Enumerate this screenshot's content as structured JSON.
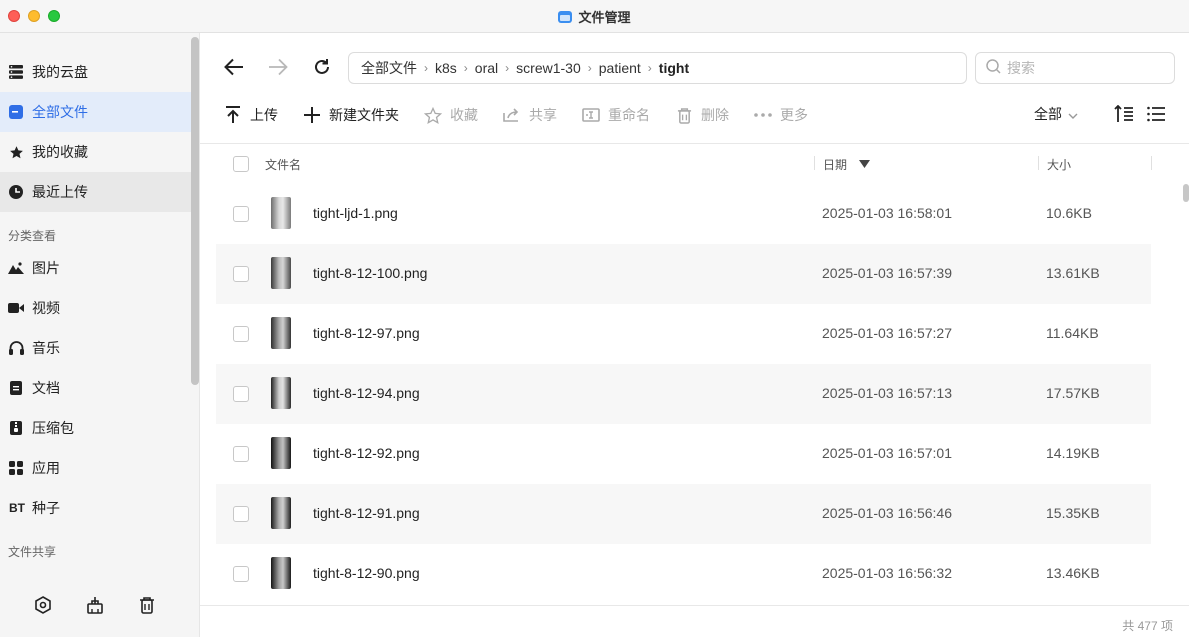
{
  "window": {
    "title": "文件管理"
  },
  "sidebar": {
    "items": [
      {
        "label": "我的云盘",
        "icon": "cloud-drive-icon",
        "state": "normal"
      },
      {
        "label": "全部文件",
        "icon": "folder-icon",
        "state": "active"
      },
      {
        "label": "我的收藏",
        "icon": "star-icon",
        "state": "normal"
      },
      {
        "label": "最近上传",
        "icon": "clock-icon",
        "state": "hover"
      }
    ],
    "section_category": "分类查看",
    "categories": [
      {
        "label": "图片",
        "icon": "image-icon"
      },
      {
        "label": "视频",
        "icon": "video-icon"
      },
      {
        "label": "音乐",
        "icon": "headphones-icon"
      },
      {
        "label": "文档",
        "icon": "document-icon"
      },
      {
        "label": "压缩包",
        "icon": "archive-icon"
      },
      {
        "label": "应用",
        "icon": "apps-icon"
      },
      {
        "label": "种子",
        "icon": "bt-icon",
        "icon_text": "BT"
      }
    ],
    "section_share": "文件共享",
    "bottom_icons": [
      "settings-icon",
      "cleanup-icon",
      "trash-icon"
    ]
  },
  "nav": {
    "breadcrumb": [
      "全部文件",
      "k8s",
      "oral",
      "screw1-30",
      "patient",
      "tight"
    ],
    "search_placeholder": "搜索"
  },
  "toolbar": {
    "upload": "上传",
    "new_folder": "新建文件夹",
    "favorite": "收藏",
    "share": "共享",
    "rename": "重命名",
    "delete": "删除",
    "more": "更多",
    "filter": "全部"
  },
  "table": {
    "headers": {
      "name": "文件名",
      "date": "日期",
      "size": "大小"
    },
    "rows": [
      {
        "name": "tight-ljd-1.png",
        "date": "2025-01-03 16:58:01",
        "size": "10.6KB"
      },
      {
        "name": "tight-8-12-100.png",
        "date": "2025-01-03 16:57:39",
        "size": "13.61KB"
      },
      {
        "name": "tight-8-12-97.png",
        "date": "2025-01-03 16:57:27",
        "size": "11.64KB"
      },
      {
        "name": "tight-8-12-94.png",
        "date": "2025-01-03 16:57:13",
        "size": "17.57KB"
      },
      {
        "name": "tight-8-12-92.png",
        "date": "2025-01-03 16:57:01",
        "size": "14.19KB"
      },
      {
        "name": "tight-8-12-91.png",
        "date": "2025-01-03 16:56:46",
        "size": "15.35KB"
      },
      {
        "name": "tight-8-12-90.png",
        "date": "2025-01-03 16:56:32",
        "size": "13.46KB"
      }
    ]
  },
  "status": {
    "total": "共 477 项"
  },
  "colors": {
    "accent": "#2f6ee6",
    "active_bg": "#e3ecfa",
    "sidebar_bg": "#f5f5f5"
  }
}
